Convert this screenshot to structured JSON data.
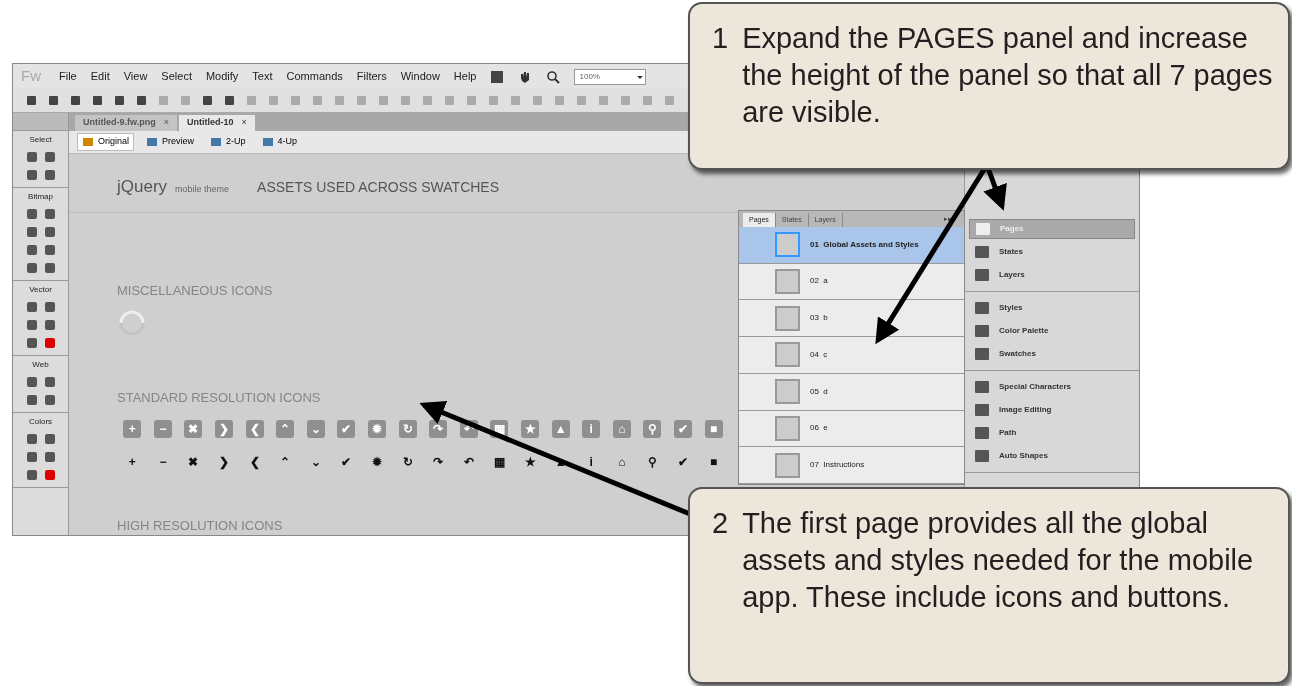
{
  "app": {
    "logo": "Fw",
    "menu": [
      "File",
      "Edit",
      "View",
      "Select",
      "Modify",
      "Text",
      "Commands",
      "Filters",
      "Window",
      "Help"
    ],
    "zoom": "100%"
  },
  "document_tabs": [
    {
      "label": "Untitled-9.fw.png",
      "selected": false,
      "close": "×"
    },
    {
      "label": "Untitled-10",
      "selected": true,
      "close": "×"
    }
  ],
  "view_modes": [
    {
      "label": "Original",
      "selected": true
    },
    {
      "label": "Preview",
      "selected": false
    },
    {
      "label": "2-Up",
      "selected": false
    },
    {
      "label": "4-Up",
      "selected": false
    }
  ],
  "tools": [
    {
      "label": "Select"
    },
    {
      "label": "Bitmap"
    },
    {
      "label": "Vector"
    },
    {
      "label": "Web"
    },
    {
      "label": "Colors"
    }
  ],
  "canvas": {
    "brand": "jQuery",
    "brand_sub": "mobile theme",
    "title": "ASSETS USED ACROSS SWATCHES",
    "misc_heading": "MISCELLANEOUS ICONS",
    "standard_heading": "STANDARD RESOLUTION ICONS",
    "high_heading": "HIGH RESOLUTION ICONS",
    "light_icons": [
      "+",
      "−",
      "✖",
      "❯",
      "❮",
      "⌃",
      "⌄",
      "✔",
      "✹",
      "↻",
      "↷",
      "↶",
      "▦",
      "★",
      "▲",
      "i",
      "⌂",
      "⚲",
      "✔",
      "■"
    ],
    "dark_icons": [
      "+",
      "−",
      "✖",
      "❯",
      "❮",
      "⌃",
      "⌄",
      "✔",
      "✹",
      "↻",
      "↷",
      "↶",
      "▦",
      "★",
      "▲",
      "i",
      "⌂",
      "⚲",
      "✔",
      "■"
    ]
  },
  "pages_panel": {
    "tabs": [
      {
        "label": "Pages",
        "selected": true
      },
      {
        "label": "States",
        "selected": false
      },
      {
        "label": "Layers",
        "selected": false
      }
    ],
    "menu": "▸▸",
    "pages": [
      {
        "number": "01",
        "name": "Global Assets and Styles",
        "selected": true
      },
      {
        "number": "02",
        "name": "a",
        "selected": false
      },
      {
        "number": "03",
        "name": "b",
        "selected": false
      },
      {
        "number": "04",
        "name": "c",
        "selected": false
      },
      {
        "number": "05",
        "name": "d",
        "selected": false
      },
      {
        "number": "06",
        "name": "e",
        "selected": false
      },
      {
        "number": "07",
        "name": "Instructions",
        "selected": false
      }
    ]
  },
  "side_panels": [
    [
      {
        "label": "Pages",
        "selected": true
      },
      {
        "label": "States",
        "selected": false
      },
      {
        "label": "Layers",
        "selected": false
      }
    ],
    [
      {
        "label": "Styles",
        "selected": false
      },
      {
        "label": "Color Palette",
        "selected": false
      },
      {
        "label": "Swatches",
        "selected": false
      }
    ],
    [
      {
        "label": "Special Characters",
        "selected": false
      },
      {
        "label": "Image Editing",
        "selected": false
      },
      {
        "label": "Path",
        "selected": false
      },
      {
        "label": "Auto Shapes",
        "selected": false
      }
    ]
  ],
  "callouts": [
    {
      "number": "1",
      "text": "Expand the PAGES panel and increase the height of the panel so that all 7 pages are visible."
    },
    {
      "number": "2",
      "text": "The first page provides all the global assets and styles needed for the mobile app.  These include icons and buttons."
    }
  ]
}
